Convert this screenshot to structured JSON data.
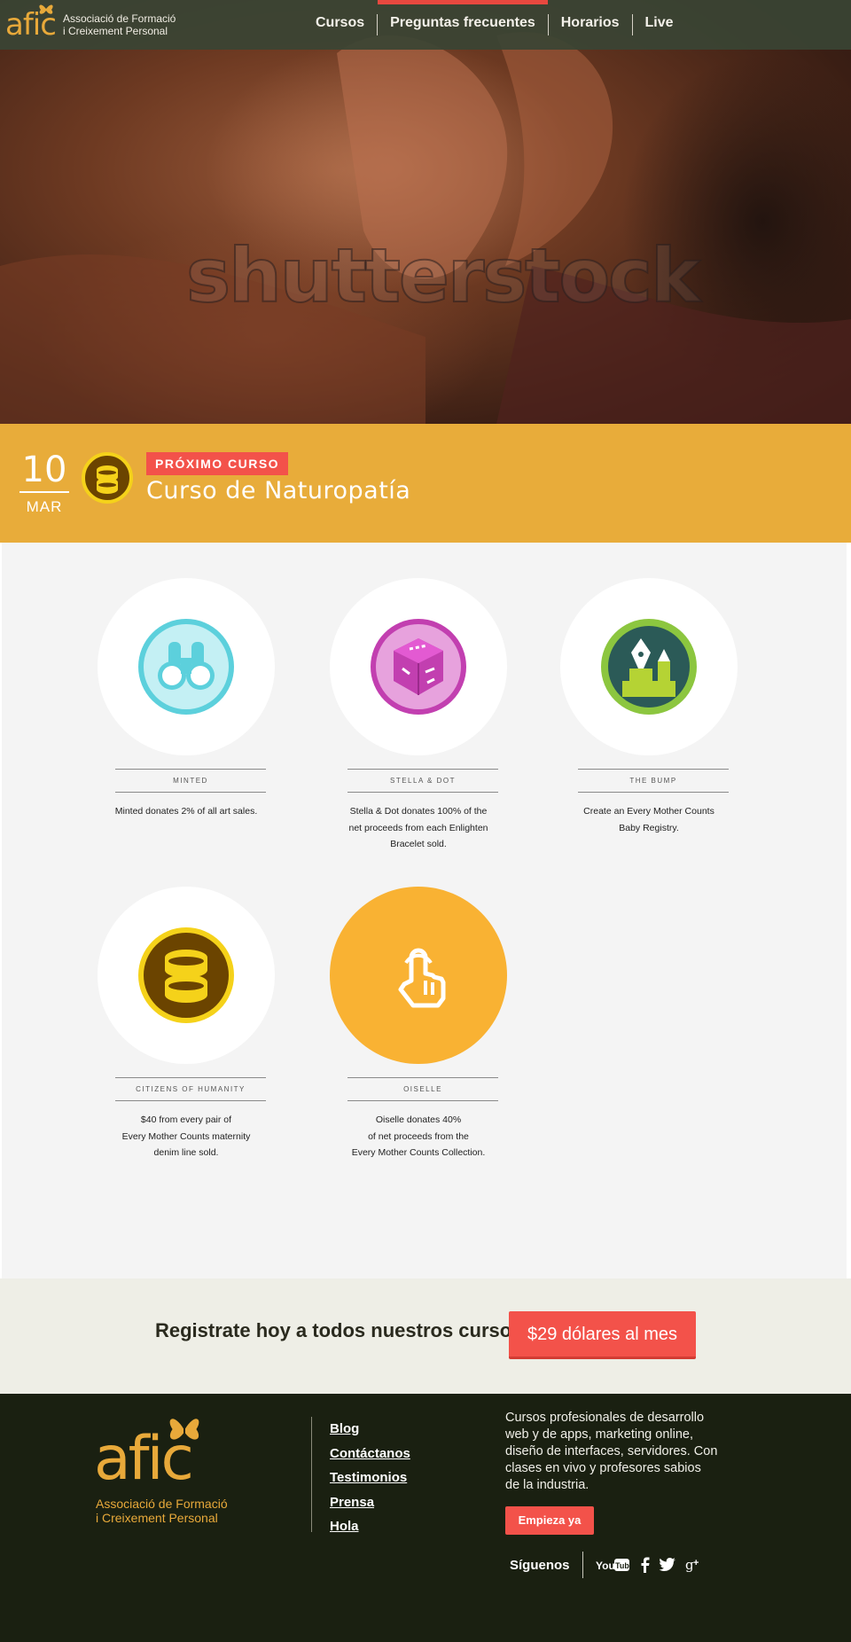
{
  "nav": {
    "logo_word": "afic",
    "logo_line1": "Associació de Formació",
    "logo_line2": "i Creixement Personal",
    "links": [
      {
        "label": "Cursos"
      },
      {
        "label": "Preguntas frecuentes"
      },
      {
        "label": "Horarios"
      },
      {
        "label": "Live"
      }
    ],
    "active_index": 1
  },
  "hero": {
    "watermark": "shutterstock"
  },
  "next_course": {
    "day": "10",
    "month": "MAR",
    "badge": "PRÓXIMO CURSO",
    "title": "Curso de Naturopatía"
  },
  "features": [
    {
      "name": "MINTED",
      "desc_lines": [
        "Minted donates 2% of all art sales."
      ],
      "icon": "binoculars-icon",
      "color": "#5cd0dc"
    },
    {
      "name": "STELLA & DOT",
      "desc_lines": [
        "Stella & Dot donates 100% of the",
        "net proceeds from each Enlighten",
        "Bracelet sold."
      ],
      "icon": "cube-icon",
      "color": "#c23fb0"
    },
    {
      "name": "THE BUMP",
      "desc_lines": [
        "Create an Every Mother Counts",
        "Baby Registry."
      ],
      "icon": "pen-pencil-icon",
      "color": "#2b5a57"
    },
    {
      "name": "CITIZENS OF HUMANITY",
      "desc_lines": [
        "$40 from every pair of",
        "Every Mother Counts maternity",
        "denim line sold."
      ],
      "icon": "coins-icon",
      "color": "#6b4400"
    },
    {
      "name": "OISELLE",
      "desc_lines": [
        "Oiselle donates 40%",
        "of net proceeds from the",
        "Every Mother Counts Collection."
      ],
      "icon": "hand-pointer-icon",
      "color": "#f9b233"
    }
  ],
  "cta": {
    "text": "Registrate hoy a todos nuestros cursos",
    "button": "$29 dólares al mes"
  },
  "footer": {
    "logo_word": "afic",
    "logo_line1": "Associació de Formació",
    "logo_line2": "i Creixement Personal",
    "links": [
      "Blog",
      "Contáctanos",
      "Testimonios",
      "Prensa",
      "Hola"
    ],
    "about": "Cursos profesionales de desarrollo web y de apps, marketing online, diseño de interfaces, servidores. Con clases en vivo y profesores sabios de la industria.",
    "button": "Empieza ya",
    "social_label": "Síguenos",
    "social": [
      "youtube-icon",
      "facebook-icon",
      "twitter-icon",
      "google-plus-icon"
    ]
  },
  "colors": {
    "accent": "#f3524a",
    "band": "#e8ac3a",
    "footer_bg": "#1a2011",
    "nav_bg": "#3a4434"
  }
}
